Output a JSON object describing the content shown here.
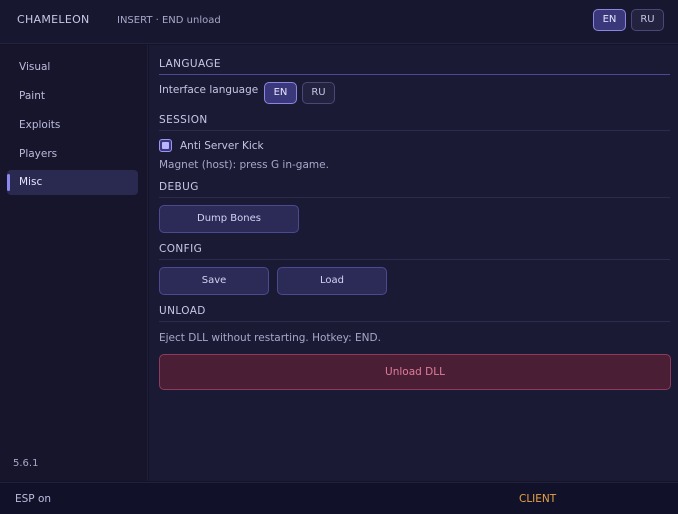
{
  "header": {
    "title": "CHAMELEON",
    "hint": "INSERT · END unload",
    "languages": [
      "EN",
      "RU"
    ],
    "active_language": "EN"
  },
  "sidebar": {
    "items": [
      {
        "label": "Visual"
      },
      {
        "label": "Paint"
      },
      {
        "label": "Exploits"
      },
      {
        "label": "Players"
      },
      {
        "label": "Misc"
      }
    ],
    "active": "Misc",
    "version": "5.6.1"
  },
  "main": {
    "language": {
      "title": "LANGUAGE",
      "label": "Interface language",
      "options": [
        "EN",
        "RU"
      ],
      "selected": "EN"
    },
    "session": {
      "title": "SESSION",
      "anti_kick_label": "Anti Server Kick",
      "anti_kick_checked": true,
      "magnet_text": "Magnet (host): press G in-game."
    },
    "debug": {
      "title": "DEBUG",
      "dump_bones_label": "Dump Bones"
    },
    "config": {
      "title": "CONFIG",
      "save_label": "Save",
      "load_label": "Load"
    },
    "unload": {
      "title": "UNLOAD",
      "description": "Eject DLL without restarting. Hotkey: END.",
      "button_label": "Unload DLL"
    }
  },
  "status": {
    "left": "ESP on",
    "right": "CLIENT"
  },
  "colors": {
    "accent": "#8d87f0",
    "danger": "#e07b98",
    "status_right": "#e6a243",
    "background": "#14132a"
  }
}
